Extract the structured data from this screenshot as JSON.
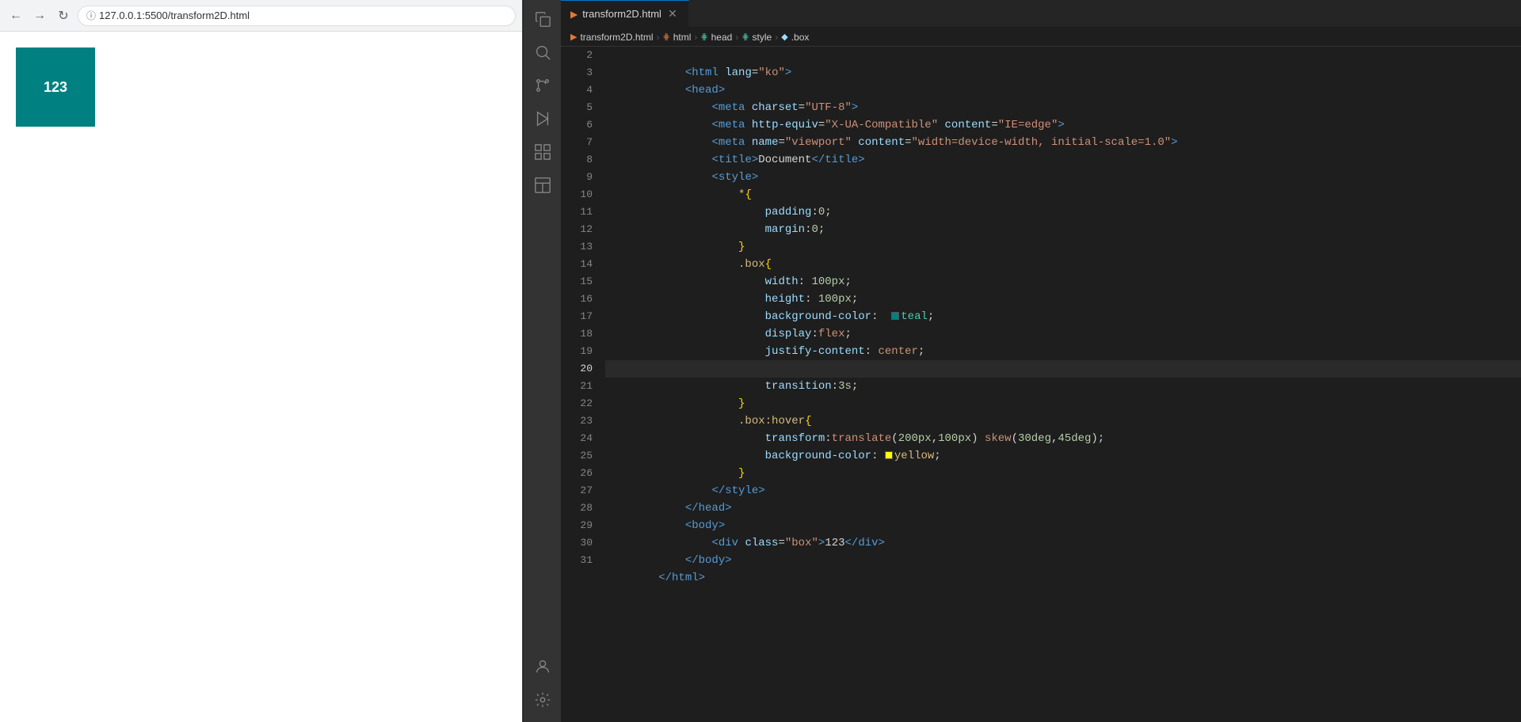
{
  "browser": {
    "url": "127.0.0.1:5500/transform2D.html",
    "demo_number": "123"
  },
  "editor": {
    "tab_name": "transform2D.html",
    "breadcrumbs": [
      {
        "label": "transform2D.html",
        "icon": "html-icon"
      },
      {
        "label": "html",
        "icon": "tag-icon"
      },
      {
        "label": "head",
        "icon": "tag-icon"
      },
      {
        "label": "style",
        "icon": "tag-icon"
      },
      {
        "label": ".box",
        "icon": "dot-icon"
      }
    ]
  },
  "activity_bar": {
    "icons": [
      {
        "name": "explorer-icon",
        "symbol": "⎘",
        "active": false
      },
      {
        "name": "search-icon",
        "symbol": "🔍",
        "active": false
      },
      {
        "name": "source-control-icon",
        "symbol": "⎇",
        "active": false
      },
      {
        "name": "run-icon",
        "symbol": "▶",
        "active": false
      },
      {
        "name": "extensions-icon",
        "symbol": "⊞",
        "active": false
      },
      {
        "name": "layout-icon",
        "symbol": "▤",
        "active": false
      }
    ],
    "bottom_icons": [
      {
        "name": "account-icon",
        "symbol": "👤"
      },
      {
        "name": "settings-icon",
        "symbol": "⚙"
      }
    ]
  }
}
